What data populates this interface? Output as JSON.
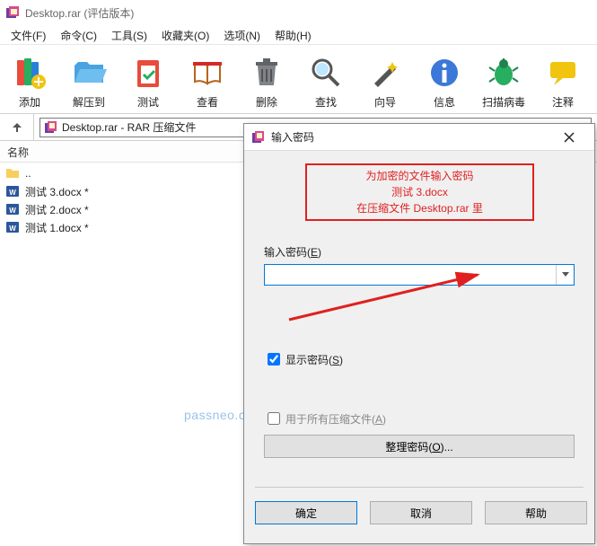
{
  "title_bar": {
    "text": "Desktop.rar (评估版本)"
  },
  "menu": {
    "file": "文件(F)",
    "command": "命令(C)",
    "tools": "工具(S)",
    "favorites": "收藏夹(O)",
    "options": "选项(N)",
    "help": "帮助(H)"
  },
  "toolbar": {
    "add": "添加",
    "extract": "解压到",
    "test": "测试",
    "view": "查看",
    "delete": "删除",
    "find": "查找",
    "wizard": "向导",
    "info": "信息",
    "scan": "扫描病毒",
    "comment": "注释"
  },
  "address": {
    "text": "Desktop.rar - RAR 压缩文件"
  },
  "list_header": {
    "name": "名称"
  },
  "files": [
    {
      "name": "..",
      "is_parent": true
    },
    {
      "name": "测试 3.docx *"
    },
    {
      "name": "测试 2.docx *"
    },
    {
      "name": "测试 1.docx *"
    }
  ],
  "dialog": {
    "title": "输入密码",
    "red_line1": "为加密的文件输入密码",
    "red_line2": "测试 3.docx",
    "red_line3": "在压缩文件 Desktop.rar 里",
    "field_label_prefix": "输入密码(",
    "field_label_key": "E",
    "field_label_suffix": ")",
    "password_value": "",
    "show_pw_prefix": "显示密码(",
    "show_pw_key": "S",
    "show_pw_suffix": ")",
    "show_pw_checked": true,
    "apply_all_prefix": "用于所有压缩文件(",
    "apply_all_key": "A",
    "apply_all_suffix": ")",
    "apply_all_checked": false,
    "manage_btn_prefix": "整理密码(",
    "manage_btn_key": "O",
    "manage_btn_suffix": ")...",
    "ok": "确定",
    "cancel": "取消",
    "help": "帮助"
  },
  "watermark": "passneo.cn"
}
